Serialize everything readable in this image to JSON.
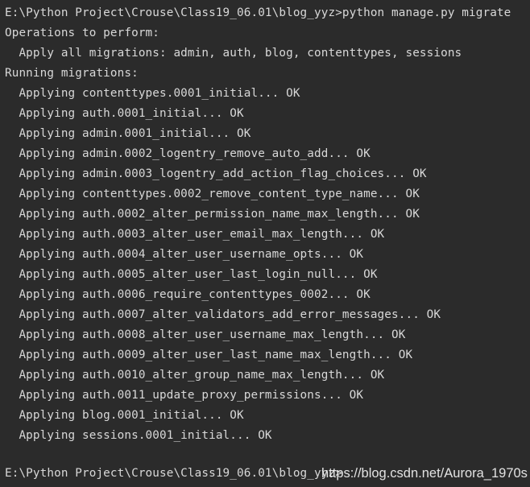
{
  "terminal": {
    "background_color": "#2b2b2b",
    "text_color": "#d8d8d8",
    "prompt_top": "E:\\Python Project\\Crouse\\Class19_06.01\\blog_yyz>python manage.py migrate",
    "lines": [
      "E:\\Python Project\\Crouse\\Class19_06.01\\blog_yyz>python manage.py migrate",
      "Operations to perform:",
      "  Apply all migrations: admin, auth, blog, contenttypes, sessions",
      "Running migrations:",
      "  Applying contenttypes.0001_initial... OK",
      "  Applying auth.0001_initial... OK",
      "  Applying admin.0001_initial... OK",
      "  Applying admin.0002_logentry_remove_auto_add... OK",
      "  Applying admin.0003_logentry_add_action_flag_choices... OK",
      "  Applying contenttypes.0002_remove_content_type_name... OK",
      "  Applying auth.0002_alter_permission_name_max_length... OK",
      "  Applying auth.0003_alter_user_email_max_length... OK",
      "  Applying auth.0004_alter_user_username_opts... OK",
      "  Applying auth.0005_alter_user_last_login_null... OK",
      "  Applying auth.0006_require_contenttypes_0002... OK",
      "  Applying auth.0007_alter_validators_add_error_messages... OK",
      "  Applying auth.0008_alter_user_username_max_length... OK",
      "  Applying auth.0009_alter_user_last_name_max_length... OK",
      "  Applying auth.0010_alter_group_name_max_length... OK",
      "  Applying auth.0011_update_proxy_permissions... OK",
      "  Applying blog.0001_initial... OK",
      "  Applying sessions.0001_initial... OK",
      ""
    ],
    "prompt_bottom": "E:\\Python Project\\Crouse\\Class19_06.01\\blog_yyz>",
    "command": "python manage.py migrate",
    "operations_header": "Operations to perform:",
    "apply_all_migrations": "  Apply all migrations: admin, auth, blog, contenttypes, sessions",
    "running_header": "Running migrations:"
  },
  "watermark": {
    "text": "https://blog.csdn.net/Aurora_1970s",
    "color": "#f2f2f2"
  }
}
